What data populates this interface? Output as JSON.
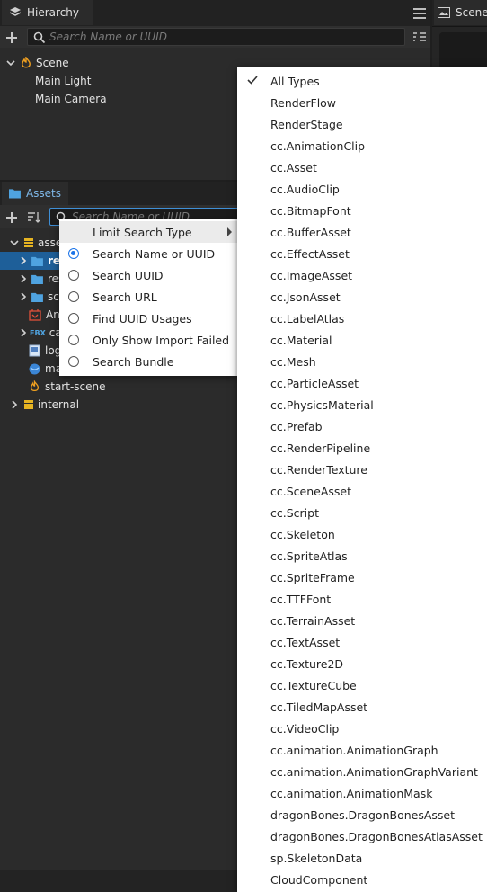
{
  "hierarchy": {
    "tab_label": "Hierarchy",
    "search_placeholder": "Search Name or UUID",
    "tree": {
      "root": "Scene",
      "children": [
        "Main Light",
        "Main Camera"
      ]
    }
  },
  "scene_tab": {
    "label": "Scene"
  },
  "assets": {
    "tab_label": "Assets",
    "search_placeholder": "Search Name or UUID",
    "tree": {
      "root": "assets",
      "rows": [
        {
          "label": "res",
          "type": "folder",
          "expanded": false,
          "selected": true
        },
        {
          "label": "res",
          "type": "folder",
          "expanded": false
        },
        {
          "label": "sc",
          "type": "folder",
          "expanded": false
        },
        {
          "label": "An",
          "type": "anim"
        },
        {
          "label": "ca",
          "type": "fbx",
          "badge": "FBX"
        },
        {
          "label": "log",
          "type": "image"
        },
        {
          "label": "ma",
          "type": "material"
        },
        {
          "label": "start-scene",
          "type": "scene"
        }
      ],
      "internal": "internal"
    }
  },
  "search_mode_menu": {
    "submenu_label": "Limit Search Type",
    "items": [
      {
        "label": "Search Name or UUID",
        "selected": true
      },
      {
        "label": "Search UUID",
        "selected": false
      },
      {
        "label": "Search URL",
        "selected": false
      },
      {
        "label": "Find UUID Usages",
        "selected": false
      },
      {
        "label": "Only Show Import Failed",
        "selected": false
      },
      {
        "label": "Search Bundle",
        "selected": false
      }
    ]
  },
  "type_menu": {
    "checked_index": 0,
    "items": [
      "All Types",
      "RenderFlow",
      "RenderStage",
      "cc.AnimationClip",
      "cc.Asset",
      "cc.AudioClip",
      "cc.BitmapFont",
      "cc.BufferAsset",
      "cc.EffectAsset",
      "cc.ImageAsset",
      "cc.JsonAsset",
      "cc.LabelAtlas",
      "cc.Material",
      "cc.Mesh",
      "cc.ParticleAsset",
      "cc.PhysicsMaterial",
      "cc.Prefab",
      "cc.RenderPipeline",
      "cc.RenderTexture",
      "cc.SceneAsset",
      "cc.Script",
      "cc.Skeleton",
      "cc.SpriteAtlas",
      "cc.SpriteFrame",
      "cc.TTFFont",
      "cc.TerrainAsset",
      "cc.TextAsset",
      "cc.Texture2D",
      "cc.TextureCube",
      "cc.TiledMapAsset",
      "cc.VideoClip",
      "cc.animation.AnimationGraph",
      "cc.animation.AnimationGraphVariant",
      "cc.animation.AnimationMask",
      "dragonBones.DragonBonesAsset",
      "dragonBones.DragonBonesAtlasAsset",
      "sp.SkeletonData",
      "CloudComponent"
    ]
  },
  "colors": {
    "accent": "#1a73e8",
    "selection": "#1e5f99",
    "scene_icon": "#f0a020"
  }
}
